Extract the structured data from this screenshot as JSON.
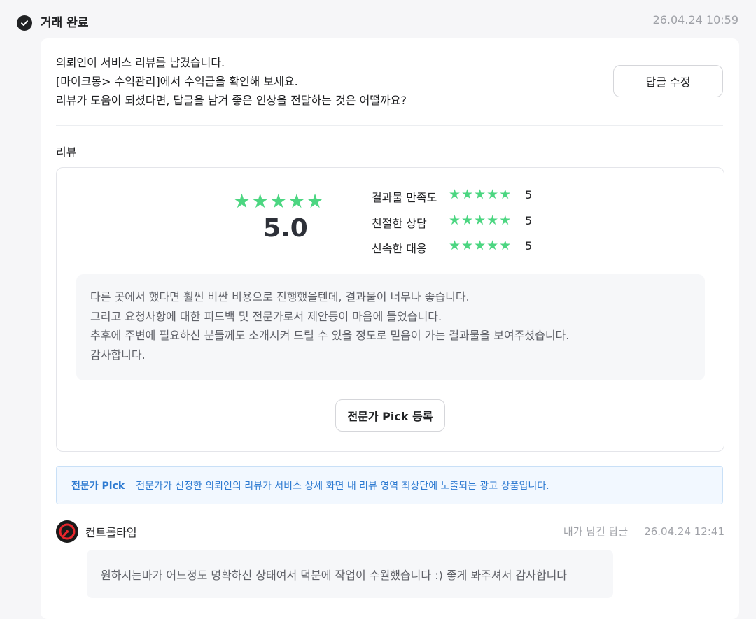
{
  "status": {
    "title": "거래 완료",
    "timestamp": "26.04.24 10:59"
  },
  "notice": {
    "lines": [
      "의뢰인이 서비스 리뷰를 남겼습니다.",
      "[마이크몽> 수익관리]에서 수익금을 확인해 보세요.",
      "리뷰가 도움이 되셨다면, 답글을 남겨 좋은 인상을 전달하는 것은 어떨까요?"
    ],
    "edit_reply_label": "답글 수정"
  },
  "review": {
    "heading": "리뷰",
    "overall_score": "5.0",
    "overall_stars": 5,
    "criteria": [
      {
        "label": "결과물 만족도",
        "score": "5"
      },
      {
        "label": "친절한 상담",
        "score": "5"
      },
      {
        "label": "신속한 대응",
        "score": "5"
      }
    ],
    "text_lines": [
      "다른 곳에서 했다면 훨씬 비싼 비용으로 진행했을텐데, 결과물이 너무나 좋습니다.",
      "그리고 요청사항에 대한 피드백 및 전문가로서 제안등이 마음에 들었습니다.",
      "추후에 주변에 필요하신 분들께도 소개시켜 드릴 수 있을 정도로 믿음이 가는 결과물을 보여주셨습니다.",
      "감사합니다."
    ],
    "pick_button_label": "전문가 Pick 등록"
  },
  "pick_info": {
    "title": "전문가 Pick",
    "description": "전문가가 선정한 의뢰인의 리뷰가 서비스 상세 화면 내 리뷰 영역 최상단에 노출되는 광고 상품입니다."
  },
  "reply": {
    "author": "컨트롤타임",
    "meta_label": "내가 남긴 답글",
    "timestamp": "26.04.24 12:41",
    "text": "원하시는바가 어느정도 명확하신 상태여서 덕분에 작업이 수월했습니다 :) 좋게 봐주셔서 감사합니다"
  },
  "colors": {
    "star": "#4cd681",
    "pick_accent": "#2d7ad1",
    "pick_bg": "#f2f8ff"
  },
  "icons": {
    "status": "check-circle-icon",
    "star": "star-icon",
    "avatar": "logo-avatar-icon"
  }
}
